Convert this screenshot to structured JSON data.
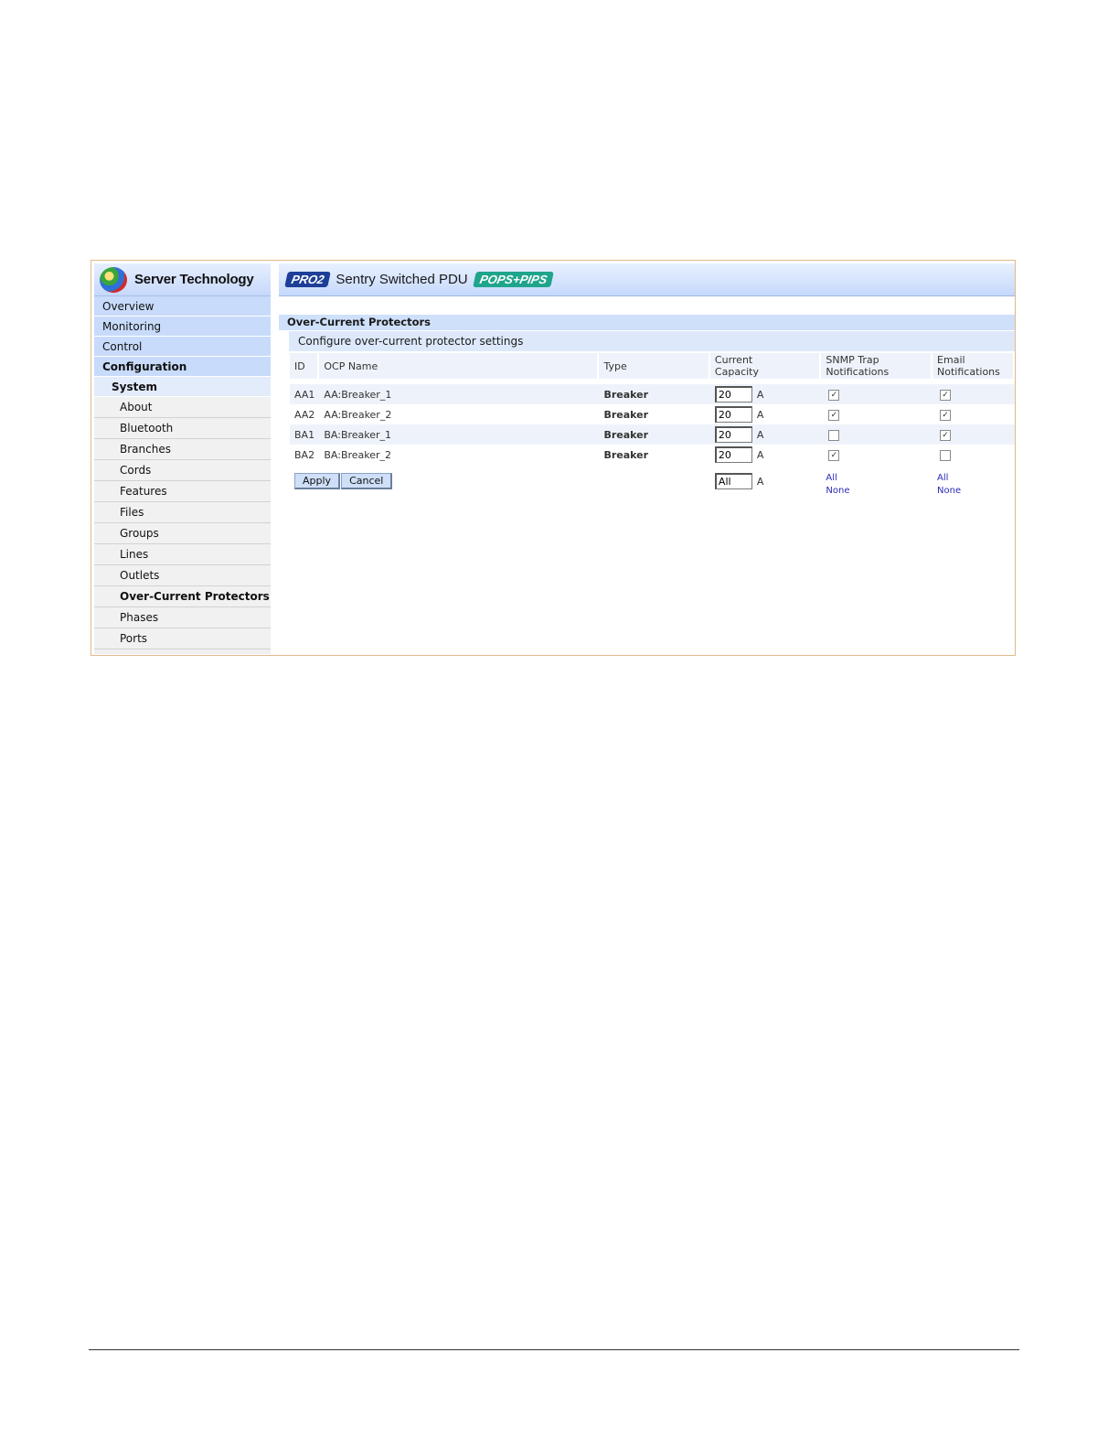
{
  "brand": {
    "name": "Server Technology",
    "logo_icon": "globe-logo-icon"
  },
  "header": {
    "badge_left": "PRO2",
    "title": "Sentry Switched PDU",
    "badge_right": "POPS+PIPS"
  },
  "sidebar": {
    "top_items": [
      {
        "label": "Overview"
      },
      {
        "label": "Monitoring"
      },
      {
        "label": "Control"
      },
      {
        "label": "Configuration"
      }
    ],
    "system_label": "System",
    "sub_items": [
      {
        "label": "About"
      },
      {
        "label": "Bluetooth"
      },
      {
        "label": "Branches"
      },
      {
        "label": "Cords"
      },
      {
        "label": "Features"
      },
      {
        "label": "Files"
      },
      {
        "label": "Groups"
      },
      {
        "label": "Lines"
      },
      {
        "label": "Outlets"
      },
      {
        "label": "Over-Current Protectors"
      },
      {
        "label": "Phases"
      },
      {
        "label": "Ports"
      }
    ]
  },
  "main": {
    "section_title": "Over-Current Protectors",
    "section_subtitle": "Configure over-current protector settings",
    "columns": {
      "id": "ID",
      "name": "OCP Name",
      "type": "Type",
      "capacity_1": "Current",
      "capacity_2": "Capacity",
      "snmp_1": "SNMP Trap",
      "snmp_2": "Notifications",
      "email_1": "Email",
      "email_2": "Notifications"
    },
    "rows": [
      {
        "id": "AA1",
        "name": "AA:Breaker_1",
        "type": "Breaker",
        "capacity": "20",
        "unit": "A",
        "snmp": true,
        "email": true
      },
      {
        "id": "AA2",
        "name": "AA:Breaker_2",
        "type": "Breaker",
        "capacity": "20",
        "unit": "A",
        "snmp": true,
        "email": true
      },
      {
        "id": "BA1",
        "name": "BA:Breaker_1",
        "type": "Breaker",
        "capacity": "20",
        "unit": "A",
        "snmp": false,
        "email": true
      },
      {
        "id": "BA2",
        "name": "BA:Breaker_2",
        "type": "Breaker",
        "capacity": "20",
        "unit": "A",
        "snmp": true,
        "email": false
      }
    ],
    "footer": {
      "apply": "Apply",
      "cancel": "Cancel",
      "all_capacity": "All",
      "unit": "A",
      "snmp_all": "All",
      "snmp_none": "None",
      "email_all": "All",
      "email_none": "None"
    }
  },
  "colors": {
    "frame_border": "#e2b98a",
    "nav_blue": "#c8dbfb",
    "header_blue": "#c5d9fb",
    "link_blue": "#2a2ab8",
    "badge_pro": "#1d3f97",
    "badge_pops": "#1fa58c"
  }
}
